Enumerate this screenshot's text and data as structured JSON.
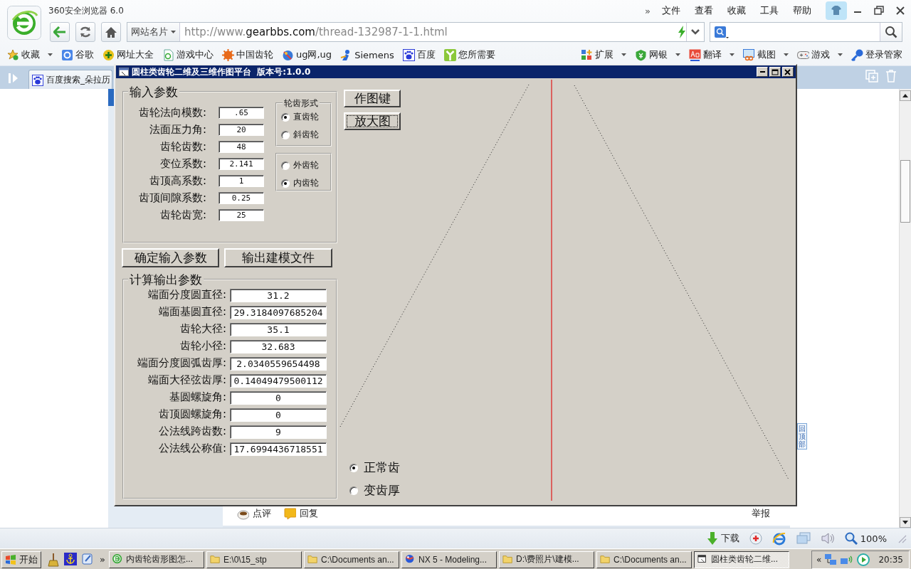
{
  "browser": {
    "title": "360安全浏览器 6.0",
    "menu": [
      "»",
      "文件",
      "查看",
      "收藏",
      "工具",
      "帮助"
    ],
    "address": {
      "prefix": "网站名片",
      "url_start": "http://www.",
      "url_domain": "gearbbs.com",
      "url_path": "/thread-132987-1-1.html"
    },
    "bookmarks": [
      {
        "label": "收藏",
        "kind": "star",
        "dropdown": true
      },
      {
        "label": "谷歌",
        "kind": "google",
        "dropdown": false
      },
      {
        "label": "网址大全",
        "kind": "plus",
        "dropdown": false
      },
      {
        "label": "游戏中心",
        "kind": "page",
        "dropdown": false
      },
      {
        "label": "中国齿轮",
        "kind": "gear",
        "dropdown": false
      },
      {
        "label": "ug网,ug",
        "kind": "globe",
        "dropdown": false
      },
      {
        "label": "Siemens",
        "kind": "person",
        "dropdown": false
      },
      {
        "label": "百度",
        "kind": "paw",
        "dropdown": false
      },
      {
        "label": "您所需要",
        "kind": "leaf",
        "dropdown": false
      }
    ],
    "tools": [
      {
        "label": "扩展",
        "kind": "blocks",
        "dropdown": true
      },
      {
        "label": "网银",
        "kind": "shield",
        "dropdown": true
      },
      {
        "label": "翻译",
        "kind": "dict",
        "dropdown": true
      },
      {
        "label": "截图",
        "kind": "screen",
        "dropdown": true
      },
      {
        "label": "游戏",
        "kind": "gamepad",
        "dropdown": true
      },
      {
        "label": "登录管家",
        "kind": "key",
        "dropdown": false
      }
    ],
    "tabs": [
      {
        "label": "百度搜索_朵拉历"
      }
    ]
  },
  "dialog": {
    "title": "圆柱类齿轮二维及三维作图平台  版本号:1.0.0",
    "input_group": {
      "title": "输入参数",
      "fields": [
        {
          "label": "齿轮法向模数:",
          "value": ".65"
        },
        {
          "label": "法面压力角:",
          "value": "20"
        },
        {
          "label": "齿轮齿数:",
          "value": "48"
        },
        {
          "label": "变位系数:",
          "value": "2.141"
        },
        {
          "label": "齿顶高系数:",
          "value": "1"
        },
        {
          "label": "齿顶间隙系数:",
          "value": "0.25"
        },
        {
          "label": "齿轮齿宽:",
          "value": "25"
        }
      ]
    },
    "tooth_form": {
      "title": "轮齿形式",
      "options": [
        {
          "label": "直齿轮",
          "selected": true
        },
        {
          "label": "斜齿轮",
          "selected": false
        }
      ]
    },
    "gear_type": {
      "options": [
        {
          "label": "外齿轮",
          "selected": false
        },
        {
          "label": "内齿轮",
          "selected": true
        }
      ]
    },
    "buttons": [
      "确定输入参数",
      "输出建模文件"
    ],
    "output_group": {
      "title": "计算输出参数",
      "fields": [
        {
          "label": "端面分度圆直径:",
          "value": "31.2"
        },
        {
          "label": "端面基圆直径:",
          "value": "29.3184097685204"
        },
        {
          "label": "齿轮大径:",
          "value": "35.1"
        },
        {
          "label": "齿轮小径:",
          "value": "32.683"
        },
        {
          "label": "端面分度圆弧齿厚:",
          "value": "2.0340559654498"
        },
        {
          "label": "端面大径弦齿厚:",
          "value": "0.14049479500112"
        },
        {
          "label": "基圆螺旋角:",
          "value": "0"
        },
        {
          "label": "齿顶圆螺旋角:",
          "value": "0"
        },
        {
          "label": "公法线跨齿数:",
          "value": "9"
        },
        {
          "label": "公法线公称值:",
          "value": "17.6994436718551"
        }
      ]
    },
    "side_buttons": [
      {
        "label": "作图键",
        "focused": false
      },
      {
        "label": "放大图",
        "focused": true
      }
    ],
    "profile_options": [
      {
        "label": "正常齿",
        "selected": true
      },
      {
        "label": "变齿厚",
        "selected": false
      }
    ]
  },
  "page": {
    "actions": [
      {
        "label": "点评",
        "kind": "comment"
      },
      {
        "label": "回复",
        "kind": "reply"
      }
    ],
    "report": "举报",
    "back_to_top": "回顶部"
  },
  "status_bar": {
    "download": "下载",
    "zoom": "100%"
  },
  "taskbar": {
    "start": "开始",
    "more": "»",
    "tasks": [
      {
        "label": "内齿轮齿形图怎...",
        "kind": "browser",
        "selected": false
      },
      {
        "label": "E:\\0\\15_stp",
        "kind": "folder",
        "selected": false
      },
      {
        "label": "C:\\Documents an...",
        "kind": "folder",
        "selected": false
      },
      {
        "label": "NX 5 - Modeling...",
        "kind": "app",
        "selected": false
      },
      {
        "label": "D:\\费照片\\建模...",
        "kind": "folder",
        "selected": false
      },
      {
        "label": "C:\\Documents an...",
        "kind": "folder",
        "selected": false
      },
      {
        "label": "圆柱类齿轮二维...",
        "kind": "window",
        "selected": true
      }
    ],
    "tray_expand": "«",
    "clock": "20:35"
  }
}
